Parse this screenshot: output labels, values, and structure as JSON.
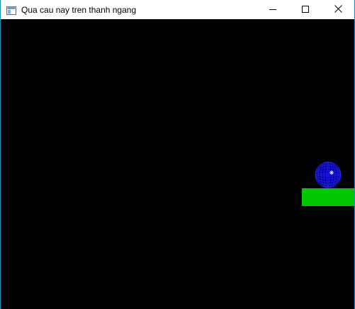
{
  "window": {
    "title": "Qua cau nay tren thanh ngang"
  },
  "titlebar": {
    "app_icon": "window-app-icon",
    "controls": [
      {
        "name": "minimize",
        "icon": "minimize-icon"
      },
      {
        "name": "maximize",
        "icon": "maximize-icon"
      },
      {
        "name": "close",
        "icon": "close-icon"
      }
    ]
  },
  "scene": {
    "background_color": "#000000",
    "ball": {
      "color": "#0000ff",
      "highlight": "#ffffff",
      "icon": "wireframe-sphere"
    },
    "platform": {
      "color": "#00c800"
    }
  }
}
